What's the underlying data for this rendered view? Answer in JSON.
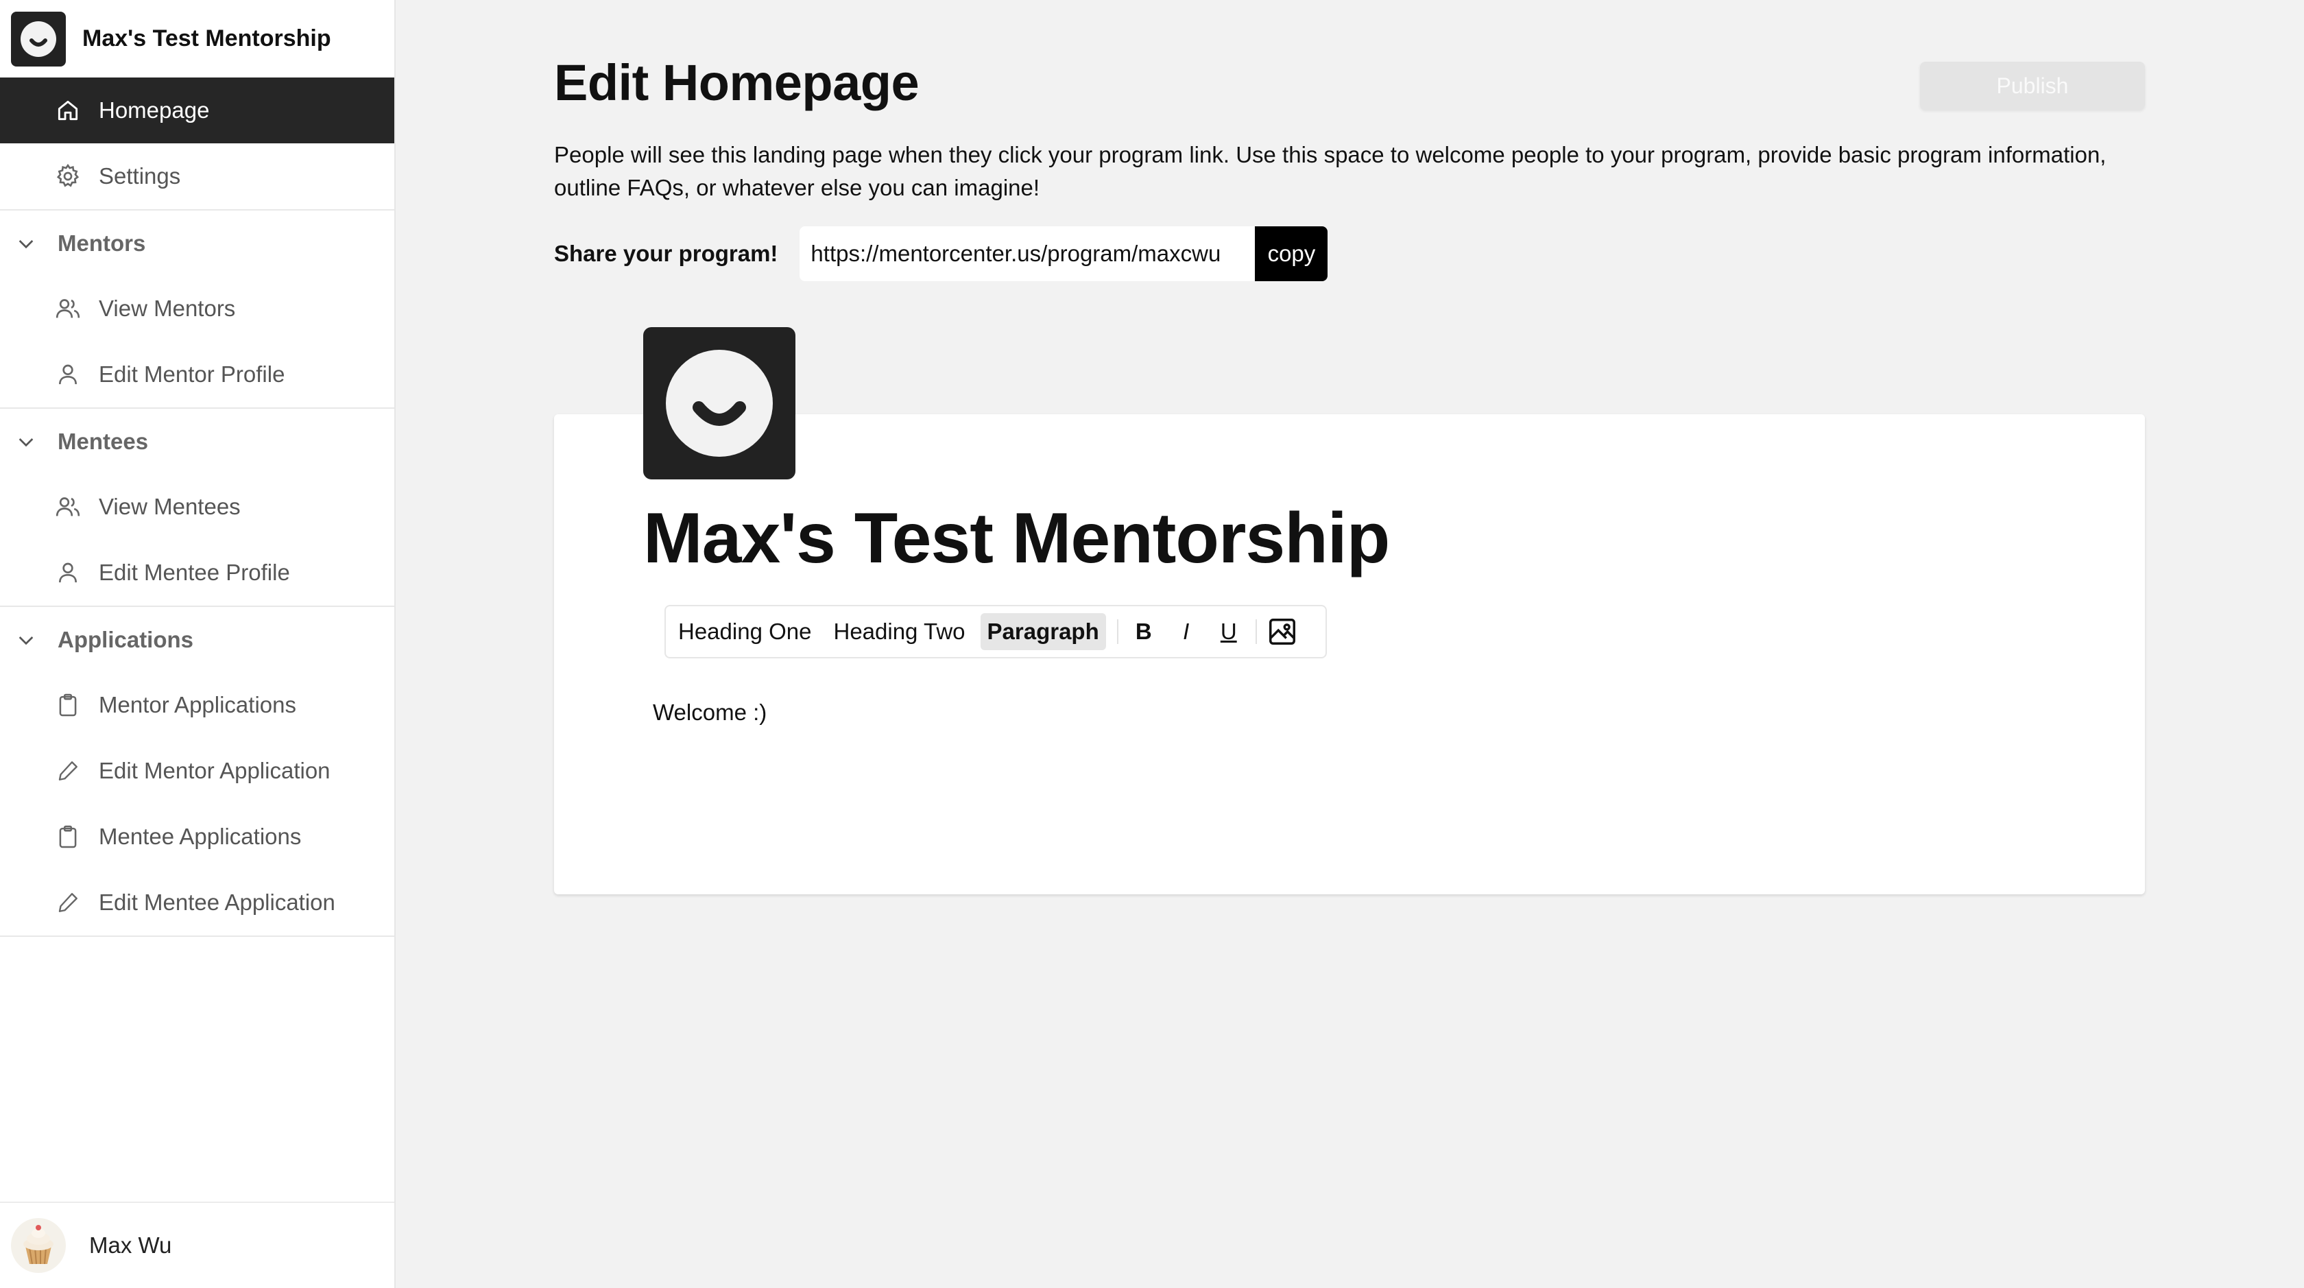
{
  "sidebar": {
    "program_name": "Max's Test Mentorship",
    "items": [
      {
        "label": "Homepage",
        "icon": "home-icon",
        "active": true
      },
      {
        "label": "Settings",
        "icon": "gear-icon",
        "active": false
      }
    ],
    "sections": [
      {
        "title": "Mentors",
        "items": [
          {
            "label": "View Mentors",
            "icon": "users-icon"
          },
          {
            "label": "Edit Mentor Profile",
            "icon": "user-icon"
          }
        ]
      },
      {
        "title": "Mentees",
        "items": [
          {
            "label": "View Mentees",
            "icon": "users-icon"
          },
          {
            "label": "Edit Mentee Profile",
            "icon": "user-icon"
          }
        ]
      },
      {
        "title": "Applications",
        "items": [
          {
            "label": "Mentor Applications",
            "icon": "clipboard-icon"
          },
          {
            "label": "Edit Mentor Application",
            "icon": "pencil-icon"
          },
          {
            "label": "Mentee Applications",
            "icon": "clipboard-icon"
          },
          {
            "label": "Edit Mentee Application",
            "icon": "pencil-icon"
          }
        ]
      }
    ],
    "user": {
      "name": "Max Wu",
      "avatar_icon": "cupcake-avatar"
    }
  },
  "main": {
    "title": "Edit Homepage",
    "publish_label": "Publish",
    "description": "People will see this landing page when they click your program link. Use this space to welcome people to your program, provide basic program information, outline FAQs, or whatever else you can imagine!",
    "share_label": "Share your program!",
    "share_url": "https://mentorcenter.us/program/maxcwu",
    "copy_label": "copy"
  },
  "editor": {
    "program_title": "Max's Test Mentorship",
    "toolbar": {
      "heading_one": "Heading One",
      "heading_two": "Heading Two",
      "paragraph": "Paragraph",
      "selected": "Paragraph",
      "bold": "B",
      "italic": "I",
      "underline": "U",
      "image_icon": "image-icon"
    },
    "body_text": "Welcome :)"
  },
  "colors": {
    "sidebar_active_bg": "#262626",
    "page_bg": "#f2f2f2",
    "logo_bg": "#222222",
    "copy_button_bg": "#000000",
    "publish_disabled_bg": "#e4e4e4"
  }
}
